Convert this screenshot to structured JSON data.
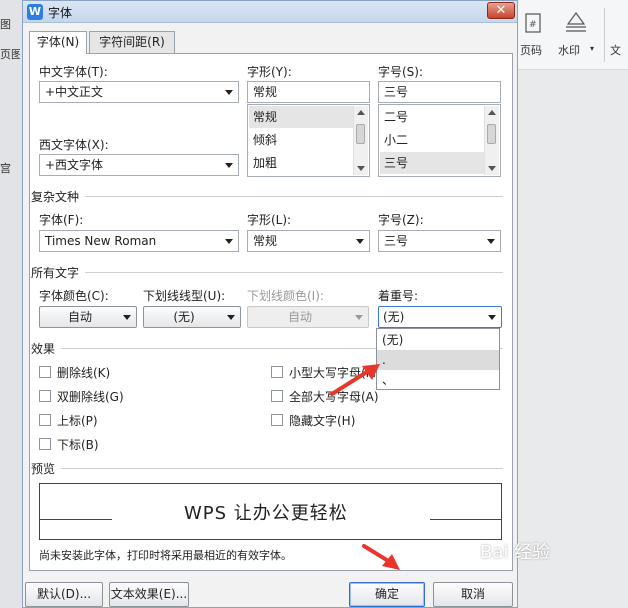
{
  "background": {
    "toolbar_items": [
      "页码",
      "水印",
      "文"
    ],
    "left_labels": [
      "图",
      "页图",
      "宫"
    ]
  },
  "dialog": {
    "title": "字体",
    "title_icon": "W",
    "close_label": "✕",
    "tabs": [
      {
        "label": "字体(N)",
        "active": true
      },
      {
        "label": "字符间距(R)",
        "active": false
      }
    ],
    "chinese_font": {
      "label": "中文字体(T):",
      "value": "+中文正文"
    },
    "western_font": {
      "label": "西文字体(X):",
      "value": "+西文字体"
    },
    "style": {
      "label": "字形(Y):",
      "value": "常规",
      "options": [
        "常规",
        "倾斜",
        "加粗"
      ],
      "selected": 0
    },
    "size": {
      "label": "字号(S):",
      "value": "三号",
      "options": [
        "二号",
        "小二",
        "三号"
      ],
      "selected": 2
    },
    "complex": {
      "section_label": "复杂文种",
      "font_label": "字体(F):",
      "font_value": "Times New Roman",
      "style_label": "字形(L):",
      "style_value": "常规",
      "size_label": "字号(Z):",
      "size_value": "三号"
    },
    "all_text": {
      "section_label": "所有文字",
      "color_label": "字体颜色(C):",
      "color_value": "自动",
      "underline_label": "下划线线型(U):",
      "underline_value": "(无)",
      "underline_color_label": "下划线颜色(I):",
      "underline_color_value": "自动",
      "emphasis_label": "着重号:",
      "emphasis_value": "(无)",
      "emphasis_options": [
        "(无)",
        ".",
        "、"
      ]
    },
    "effects": {
      "section_label": "效果",
      "left": [
        "删除线(K)",
        "双删除线(G)",
        "上标(P)",
        "下标(B)"
      ],
      "right": [
        "小型大写字母(M)",
        "全部大写字母(A)",
        "隐藏文字(H)"
      ]
    },
    "preview": {
      "section_label": "预览",
      "text": "WPS 让办公更轻松",
      "note": "尚未安装此字体，打印时将采用最相近的有效字体。"
    },
    "buttons": {
      "default": "默认(D)...",
      "text_effect": "文本效果(E)...",
      "ok": "确定",
      "cancel": "取消"
    },
    "accent_color": "#e8362b"
  },
  "watermark": "Bai 经验"
}
